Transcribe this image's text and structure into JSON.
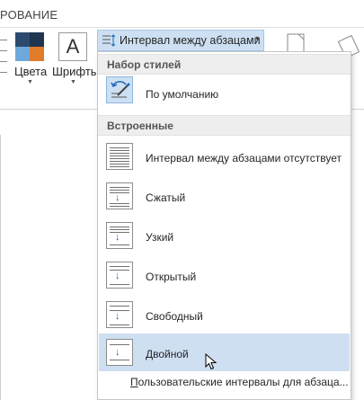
{
  "ribbon": {
    "tab_label": "РОВАНИЕ",
    "colors_label": "Цвета",
    "fonts_label": "Шрифты",
    "fonts_glyph": "A",
    "spacing_label": "Интервал между абзацами",
    "spacing_chevron": "▾",
    "colors": {
      "q1": "#2b4a6e",
      "q2": "#1f3550",
      "q3": "#6fa8dc",
      "q4": "#e07b2a"
    }
  },
  "menu": {
    "section_styles": "Набор стилей",
    "default_item": "По умолчанию",
    "section_builtin": "Встроенные",
    "items": [
      {
        "label": "Интервал между абзацами отсутствует"
      },
      {
        "label": "Сжатый"
      },
      {
        "label": "Узкий"
      },
      {
        "label": "Открытый"
      },
      {
        "label": "Свободный"
      },
      {
        "label": "Двойной"
      }
    ],
    "footer_prefix": "П",
    "footer_rest": "ользовательские интервалы для абзаца..."
  },
  "accent": "#cde0f3"
}
